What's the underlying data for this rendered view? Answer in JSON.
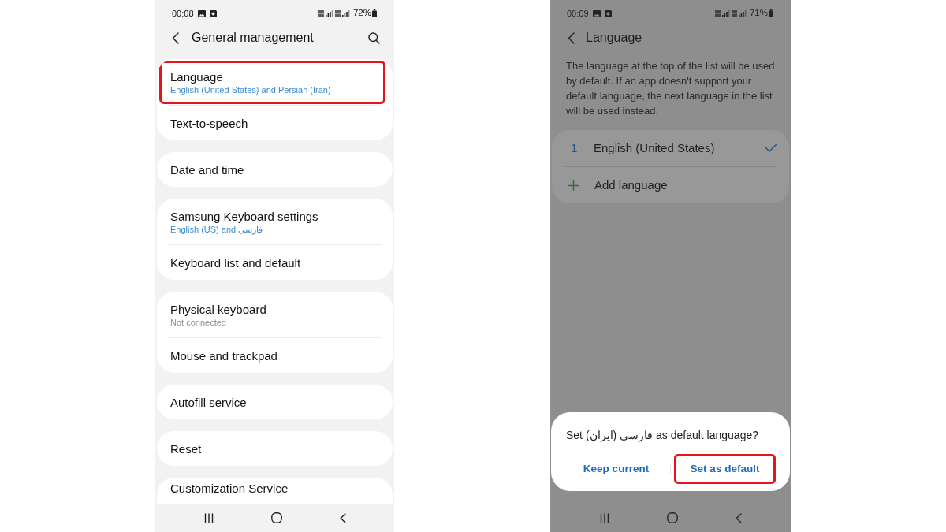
{
  "general_management_screen": {
    "dimmed": false,
    "status_bar": {
      "time": "00:08",
      "battery": "72%"
    },
    "header": {
      "title": "General management"
    },
    "groups": [
      {
        "items": [
          {
            "title": "Language",
            "subtitle": {
              "text": "English (United States) and Persian (Iran)",
              "kind": "value"
            },
            "highlighted": true
          },
          {
            "title": "Text-to-speech",
            "highlighted": false
          }
        ]
      },
      {
        "items": [
          {
            "title": "Date and time",
            "highlighted": false
          }
        ]
      },
      {
        "items": [
          {
            "title": "Samsung Keyboard settings",
            "subtitle": {
              "text": "English (US) and فارسی",
              "kind": "value"
            },
            "highlighted": false
          },
          {
            "title": "Keyboard list and default",
            "highlighted": false
          }
        ]
      },
      {
        "items": [
          {
            "title": "Physical keyboard",
            "subtitle": {
              "text": "Not connected",
              "kind": "status"
            },
            "highlighted": false
          },
          {
            "title": "Mouse and trackpad",
            "highlighted": false
          }
        ]
      },
      {
        "items": [
          {
            "title": "Autofill service",
            "highlighted": false
          }
        ]
      },
      {
        "items": [
          {
            "title": "Reset",
            "highlighted": false
          }
        ]
      },
      {
        "items": [
          {
            "title": "Customization Service",
            "highlighted": false
          }
        ]
      }
    ]
  },
  "language_screen": {
    "dimmed": true,
    "status_bar": {
      "time": "00:09",
      "battery": "71%"
    },
    "header": {
      "title": "Language"
    },
    "description": "The language at the top of the list will be used by default. If an app doesn't support your default language, the next language in the list will be used instead.",
    "languages": [
      {
        "number": "1",
        "name": "English (United States)",
        "checked": true
      }
    ],
    "add_button": {
      "label": "Add language"
    },
    "dialog": {
      "message": "Set فارسی (ایران) as default language?",
      "buttons": [
        {
          "label": "Keep current",
          "highlighted": false
        },
        {
          "label": "Set as default",
          "highlighted": true
        }
      ]
    }
  }
}
